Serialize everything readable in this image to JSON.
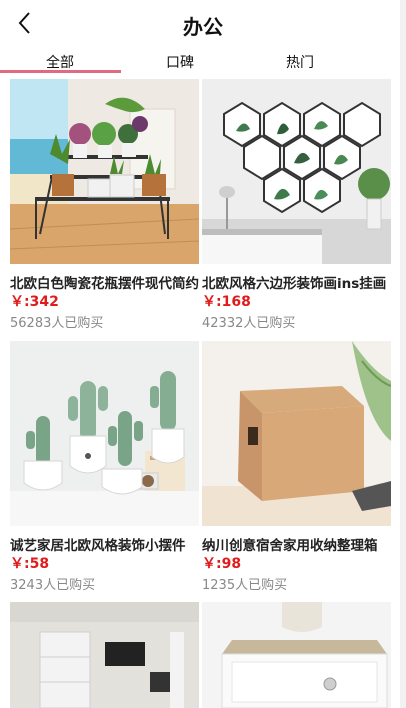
{
  "header": {
    "title": "办公",
    "back_icon": "chevron-left-icon"
  },
  "tabs": [
    {
      "label": "全部",
      "active": true
    },
    {
      "label": "口碑",
      "active": false
    },
    {
      "label": "热门",
      "active": false
    }
  ],
  "colors": {
    "accent": "#e06a7f",
    "price": "#e11b1b",
    "muted": "#888888"
  },
  "products": [
    {
      "name": "北欧白色陶瓷花瓶摆件现代简约",
      "price": "￥:342",
      "sold": "56283人已购买",
      "image": "plant-stand-on-beach-photo"
    },
    {
      "name": "北欧风格六边形装饰画ins挂画",
      "price": "￥:168",
      "sold": "42332人已购买",
      "image": "hexagon-wall-art-photo"
    },
    {
      "name": "诚艺家居北欧风格装饰小摆件",
      "price": "￥:58",
      "sold": "3243人已购买",
      "image": "cactus-ornaments-photo"
    },
    {
      "name": "纳川创意宿舍家用收纳整理箱",
      "price": "￥:98",
      "sold": "1235人已购买",
      "image": "cardboard-storage-box-photo"
    },
    {
      "name": "",
      "price": "",
      "sold": "",
      "image": "bookshelf-wall-photo"
    },
    {
      "name": "",
      "price": "",
      "sold": "",
      "image": "white-nightstand-photo"
    }
  ]
}
